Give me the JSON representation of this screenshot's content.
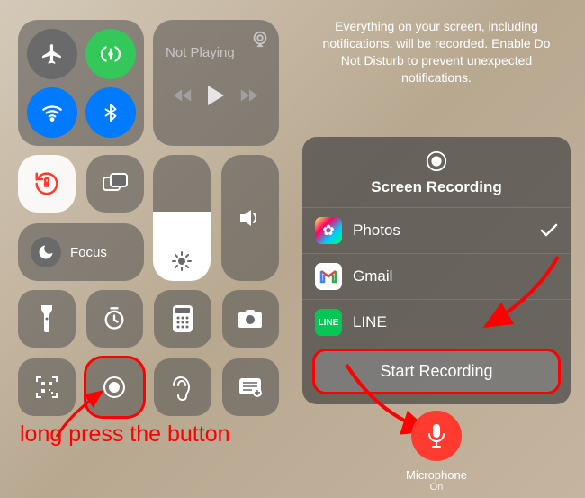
{
  "left": {
    "playback_title": "Not Playing",
    "focus_label": "Focus",
    "caption": "long press the button"
  },
  "right": {
    "blurb": "Everything on your screen, including notifications, will be recorded. Enable Do Not Disturb to prevent unexpected notifications.",
    "sheet_title": "Screen Recording",
    "rows": [
      {
        "label": "Photos",
        "selected": true
      },
      {
        "label": "Gmail",
        "selected": false
      },
      {
        "label": "LINE",
        "selected": false
      }
    ],
    "start_label": "Start Recording",
    "mic_label": "Microphone",
    "mic_state": "On"
  }
}
